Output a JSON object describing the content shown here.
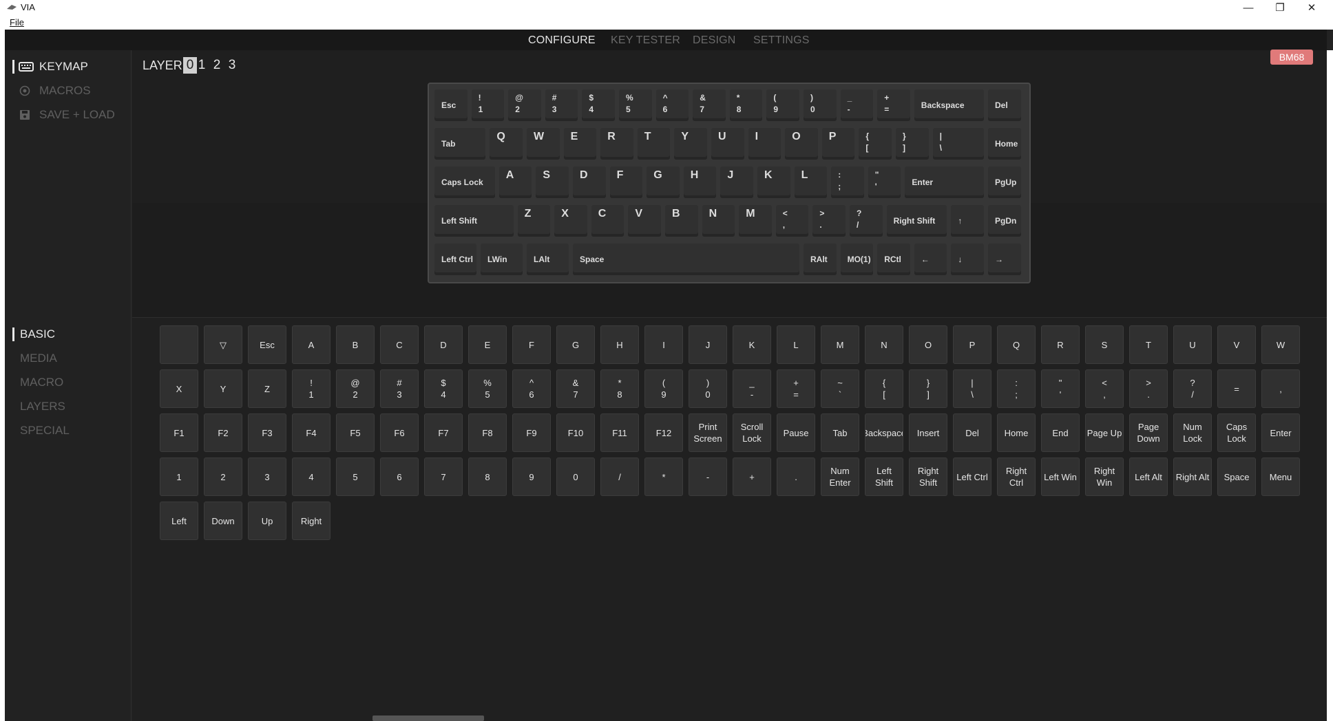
{
  "window": {
    "title": "VIA",
    "menu": [
      "File"
    ],
    "controls": {
      "minimize": "—",
      "maximize": "❐",
      "close": "✕"
    }
  },
  "topnav": {
    "tabs": [
      {
        "label": "CONFIGURE",
        "active": true
      },
      {
        "label": "KEY TESTER",
        "active": false
      },
      {
        "label": "DESIGN",
        "active": false
      },
      {
        "label": "SETTINGS",
        "active": false
      }
    ]
  },
  "sidebar_top": [
    {
      "label": "KEYMAP",
      "icon": "keyboard-icon",
      "active": true
    },
    {
      "label": "MACROS",
      "icon": "record-icon",
      "active": false
    },
    {
      "label": "SAVE + LOAD",
      "icon": "floppy-icon",
      "active": false
    }
  ],
  "sidebar_bottom": [
    {
      "label": "BASIC",
      "active": true
    },
    {
      "label": "MEDIA",
      "active": false
    },
    {
      "label": "MACRO",
      "active": false
    },
    {
      "label": "LAYERS",
      "active": false
    },
    {
      "label": "SPECIAL",
      "active": false
    }
  ],
  "layers": {
    "label": "LAYER",
    "items": [
      "0",
      "1",
      "2",
      "3"
    ],
    "active": "0"
  },
  "device": {
    "name": "BM68"
  },
  "keyboard_rows": [
    [
      {
        "l": "Esc"
      },
      {
        "t": "!",
        "b": "1"
      },
      {
        "t": "@",
        "b": "2"
      },
      {
        "t": "#",
        "b": "3"
      },
      {
        "t": "$",
        "b": "4"
      },
      {
        "t": "%",
        "b": "5"
      },
      {
        "t": "^",
        "b": "6"
      },
      {
        "t": "&",
        "b": "7"
      },
      {
        "t": "*",
        "b": "8"
      },
      {
        "t": "(",
        "b": "9"
      },
      {
        "t": ")",
        "b": "0"
      },
      {
        "t": "_",
        "b": "-"
      },
      {
        "t": "+",
        "b": "="
      },
      {
        "l": "Backspace"
      },
      {
        "l": "Del"
      }
    ],
    [
      {
        "l": "Tab"
      },
      {
        "big": "Q"
      },
      {
        "big": "W"
      },
      {
        "big": "E"
      },
      {
        "big": "R"
      },
      {
        "big": "T"
      },
      {
        "big": "Y"
      },
      {
        "big": "U"
      },
      {
        "big": "I"
      },
      {
        "big": "O"
      },
      {
        "big": "P"
      },
      {
        "t": "{",
        "b": "["
      },
      {
        "t": "}",
        "b": "]"
      },
      {
        "t": "|",
        "b": "\\"
      },
      {
        "l": "Home"
      }
    ],
    [
      {
        "l": "Caps Lock"
      },
      {
        "big": "A"
      },
      {
        "big": "S"
      },
      {
        "big": "D"
      },
      {
        "big": "F"
      },
      {
        "big": "G"
      },
      {
        "big": "H"
      },
      {
        "big": "J"
      },
      {
        "big": "K"
      },
      {
        "big": "L"
      },
      {
        "t": ":",
        "b": ";"
      },
      {
        "t": "\"",
        "b": "'"
      },
      {
        "l": "Enter"
      },
      {
        "l": "PgUp"
      }
    ],
    [
      {
        "l": "Left Shift"
      },
      {
        "big": "Z"
      },
      {
        "big": "X"
      },
      {
        "big": "C"
      },
      {
        "big": "V"
      },
      {
        "big": "B"
      },
      {
        "big": "N"
      },
      {
        "big": "M"
      },
      {
        "t": "<",
        "b": ","
      },
      {
        "t": ">",
        "b": "."
      },
      {
        "t": "?",
        "b": "/"
      },
      {
        "l": "Right Shift"
      },
      {
        "l": "↑"
      },
      {
        "l": "PgDn"
      }
    ],
    [
      {
        "l": "Left Ctrl"
      },
      {
        "l": "LWin"
      },
      {
        "l": "LAlt"
      },
      {
        "l": "Space"
      },
      {
        "l": "RAlt"
      },
      {
        "l": "MO(1)"
      },
      {
        "l": "RCtl"
      },
      {
        "l": "←"
      },
      {
        "l": "↓"
      },
      {
        "l": "→"
      }
    ]
  ],
  "palette_rows": [
    [
      [
        ""
      ],
      [
        "▽"
      ],
      [
        "Esc"
      ],
      [
        "A"
      ],
      [
        "B"
      ],
      [
        "C"
      ],
      [
        "D"
      ],
      [
        "E"
      ],
      [
        "F"
      ],
      [
        "G"
      ],
      [
        "H"
      ],
      [
        "I"
      ],
      [
        "J"
      ],
      [
        "K"
      ],
      [
        "L"
      ],
      [
        "M"
      ],
      [
        "N"
      ],
      [
        "O"
      ],
      [
        "P"
      ],
      [
        "Q"
      ],
      [
        "R"
      ],
      [
        "S"
      ],
      [
        "T"
      ],
      [
        "U"
      ],
      [
        "V"
      ],
      [
        "W"
      ]
    ],
    [
      [
        "X"
      ],
      [
        "Y"
      ],
      [
        "Z"
      ],
      [
        "!",
        "1"
      ],
      [
        "@",
        "2"
      ],
      [
        "#",
        "3"
      ],
      [
        "$",
        "4"
      ],
      [
        "%",
        "5"
      ],
      [
        "^",
        "6"
      ],
      [
        "&",
        "7"
      ],
      [
        "*",
        "8"
      ],
      [
        "(",
        "9"
      ],
      [
        ")",
        "0"
      ],
      [
        "_",
        "-"
      ],
      [
        "+",
        "="
      ],
      [
        "~",
        "`"
      ],
      [
        "{",
        "["
      ],
      [
        "}",
        "]"
      ],
      [
        "|",
        "\\"
      ],
      [
        ":",
        ";"
      ],
      [
        "\"",
        "'"
      ],
      [
        "<",
        ","
      ],
      [
        ">",
        "."
      ],
      [
        "?",
        "/"
      ],
      [
        "="
      ],
      [
        ","
      ]
    ],
    [
      [
        "F1"
      ],
      [
        "F2"
      ],
      [
        "F3"
      ],
      [
        "F4"
      ],
      [
        "F5"
      ],
      [
        "F6"
      ],
      [
        "F7"
      ],
      [
        "F8"
      ],
      [
        "F9"
      ],
      [
        "F10"
      ],
      [
        "F11"
      ],
      [
        "F12"
      ],
      [
        "Print",
        "Screen"
      ],
      [
        "Scroll",
        "Lock"
      ],
      [
        "Pause"
      ],
      [
        "Tab"
      ],
      [
        "Backspace"
      ],
      [
        "Insert"
      ],
      [
        "Del"
      ],
      [
        "Home"
      ],
      [
        "End"
      ],
      [
        "Page Up"
      ],
      [
        "Page",
        "Down"
      ],
      [
        "Num",
        "Lock"
      ],
      [
        "Caps",
        "Lock"
      ],
      [
        "Enter"
      ]
    ],
    [
      [
        "1"
      ],
      [
        "2"
      ],
      [
        "3"
      ],
      [
        "4"
      ],
      [
        "5"
      ],
      [
        "6"
      ],
      [
        "7"
      ],
      [
        "8"
      ],
      [
        "9"
      ],
      [
        "0"
      ],
      [
        "/"
      ],
      [
        "*"
      ],
      [
        "-"
      ],
      [
        "+"
      ],
      [
        "."
      ],
      [
        "Num",
        "Enter"
      ],
      [
        "Left",
        "Shift"
      ],
      [
        "Right",
        "Shift"
      ],
      [
        "Left Ctrl"
      ],
      [
        "Right",
        "Ctrl"
      ],
      [
        "Left Win"
      ],
      [
        "Right",
        "Win"
      ],
      [
        "Left Alt"
      ],
      [
        "Right Alt"
      ],
      [
        "Space"
      ],
      [
        "Menu"
      ]
    ],
    [
      [
        "Left"
      ],
      [
        "Down"
      ],
      [
        "Up"
      ],
      [
        "Right"
      ]
    ]
  ],
  "colors": {
    "badge": "#e07a7a",
    "active_text": "#e6e6e6",
    "inactive_text": "#6a6a6a"
  }
}
